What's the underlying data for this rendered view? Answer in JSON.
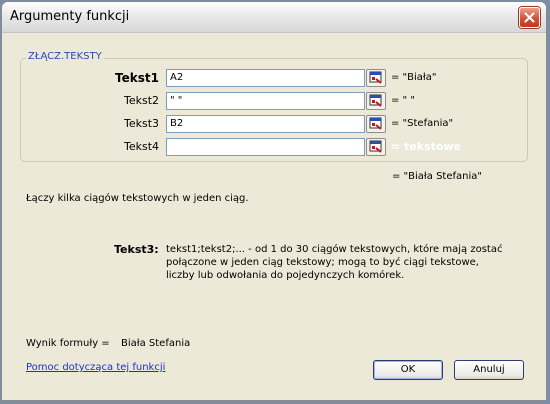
{
  "window": {
    "title": "Argumenty funkcji"
  },
  "function": {
    "name": "ZŁĄCZ.TEKSTY"
  },
  "arguments": [
    {
      "label": "Tekst1",
      "value": "A2",
      "result": "= \"Biała\""
    },
    {
      "label": "Tekst2",
      "value": "\" \"",
      "result": "= \" \""
    },
    {
      "label": "Tekst3",
      "value": "B2",
      "result": "= \"Stefania\""
    },
    {
      "label": "Tekst4",
      "value": "",
      "result": "= tekstowe"
    }
  ],
  "formula_result": "= \"Biała Stefania\"",
  "description": "Łączy kilka ciągów tekstowych w jeden ciąg.",
  "help": {
    "arg_label": "Tekst3:",
    "arg_text": "tekst1;tekst2;... - od 1 do 30 ciągów tekstowych, które mają zostać połączone w jeden ciąg tekstowy; mogą to być ciągi tekstowe, liczby lub odwołania do pojedynczych komórek."
  },
  "result": {
    "label": "Wynik formuły =",
    "value": "Biała Stefania"
  },
  "help_link": "Pomoc dotycząca tej funkcji",
  "buttons": {
    "ok": "OK",
    "cancel": "Anuluj"
  },
  "colors": {
    "accent": "#2c46b8",
    "link": "#1d2fd0",
    "dialog_bg": "#ece9d8",
    "close": "#cf4d32"
  },
  "icons": {
    "close": "close-icon",
    "ref": "range-select-icon"
  }
}
